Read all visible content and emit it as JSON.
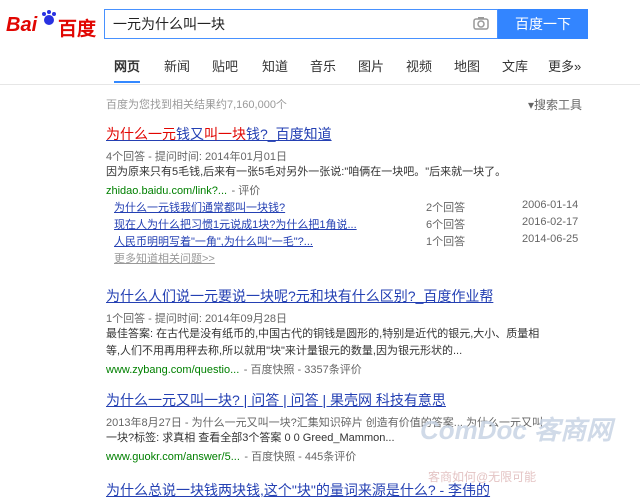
{
  "logo": {
    "left": "Bai",
    "right": "百度"
  },
  "search": {
    "query": "一元为什么叫一块",
    "button": "百度一下"
  },
  "tabs": [
    "网页",
    "新闻",
    "贴吧",
    "知道",
    "音乐",
    "图片",
    "视频",
    "地图",
    "文库",
    "更多»"
  ],
  "result_count": "百度为您找到相关结果约7,160,000个",
  "search_tools": "搜索工具",
  "r1": {
    "title_a": "为什么一元",
    "title_b": "钱又",
    "title_c": "叫一块",
    "title_d": "钱?_百度知道",
    "meta": "4个回答 - 提问时间: 2014年01月01日",
    "abs": "因为原来只有5毛钱,后来有一张5毛对另外一张说:\"咱俩在一块吧。\"后来就一块了。",
    "url": "zhidao.baidu.com/link?...",
    "rating": "- 评价",
    "subs": [
      {
        "t": "为什么一元钱我们通常都叫一块钱?",
        "c": "2个回答",
        "d": "2006-01-14"
      },
      {
        "t": "现在人为什么把习惯1元说成1块?为什么把1角说...",
        "c": "6个回答",
        "d": "2016-02-17"
      },
      {
        "t": "人民币明明写着\"一角\",为什么叫\"一毛\"?...",
        "c": "1个回答",
        "d": "2014-06-25"
      }
    ],
    "more": "更多知道相关问题>>"
  },
  "r2": {
    "title": "为什么人们说一元要说一块呢?元和块有什么区别?_百度作业帮",
    "meta": "1个回答 - 提问时间: 2014年09月28日",
    "abs1": "最佳答案: 在古代是没有纸币的,中国古代的铜钱是圆形的,特别是近代的银元,大小、质量相",
    "abs2": "等,人们不用再用秤去称,所以就用\"块\"来计量银元的数量,因为银元形状的...",
    "url": "www.zybang.com/questio...",
    "snap": "- 百度快照 - 3357条评价"
  },
  "r3": {
    "title": "为什么一元又叫一块? | 问答 | 问答 | 果壳网 科技有意思",
    "meta": "2013年8月27日 - 为什么一元又叫一块?汇集知识碎片 创造有价值的答案... 为什么一元又叫",
    "abs": "一块?标签: 求真相 查看全部3个答案 0 0 Greed_Mammon...",
    "url": "www.guokr.com/answer/5...",
    "snap": "- 百度快照 - 445条评价"
  },
  "r4": {
    "title": "为什么总说一块钱两块钱,这个\"块\"的量词来源是什么? - 李伟的"
  },
  "watermark": "ComDoc 客商网",
  "watermark_sub": "客商如何@无限可能"
}
